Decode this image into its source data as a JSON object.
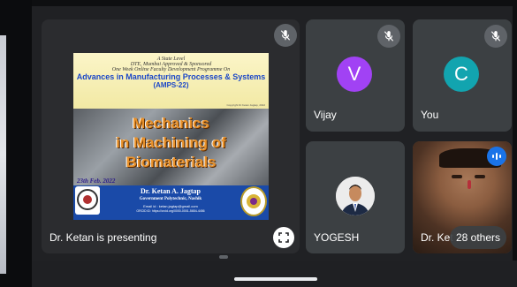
{
  "main_tile": {
    "presenting_label": "Dr. Ketan is presenting",
    "slide": {
      "line1": "A State Level",
      "line2": "DTE, Mumbai Approved & Sponsored",
      "line3": "One Week Online Faculty Development Programme On",
      "line4": "Advances in Manufacturing Processes & Systems",
      "line5": "(AMPS-22)",
      "copyright": "Copyright Dr.Ketan Jagtap, 2022",
      "title_line1": "Mechanics",
      "title_line2": "in Machining of",
      "title_line3": "Biomaterials",
      "date": "23th Feb. 2022",
      "presenter_name": "Dr. Ketan A. Jagtap",
      "presenter_inst": "Government Polytechnic, Nashik",
      "presenter_email": "Email id : ketan.jagtap@gmail.com",
      "presenter_orcid": "ORCID iD: https://orcid.org/0000-0001-5654-4456"
    }
  },
  "participants": [
    {
      "name": "Vijay",
      "initial": "V",
      "avatar_color": "#a142f4",
      "muted": true
    },
    {
      "name": "You",
      "initial": "C",
      "avatar_color": "#12a4af",
      "muted": true
    },
    {
      "name": "YOGESH",
      "muted": false
    },
    {
      "name": "Dr. Ket",
      "muted": false
    }
  ],
  "others_count_label": "28 others"
}
